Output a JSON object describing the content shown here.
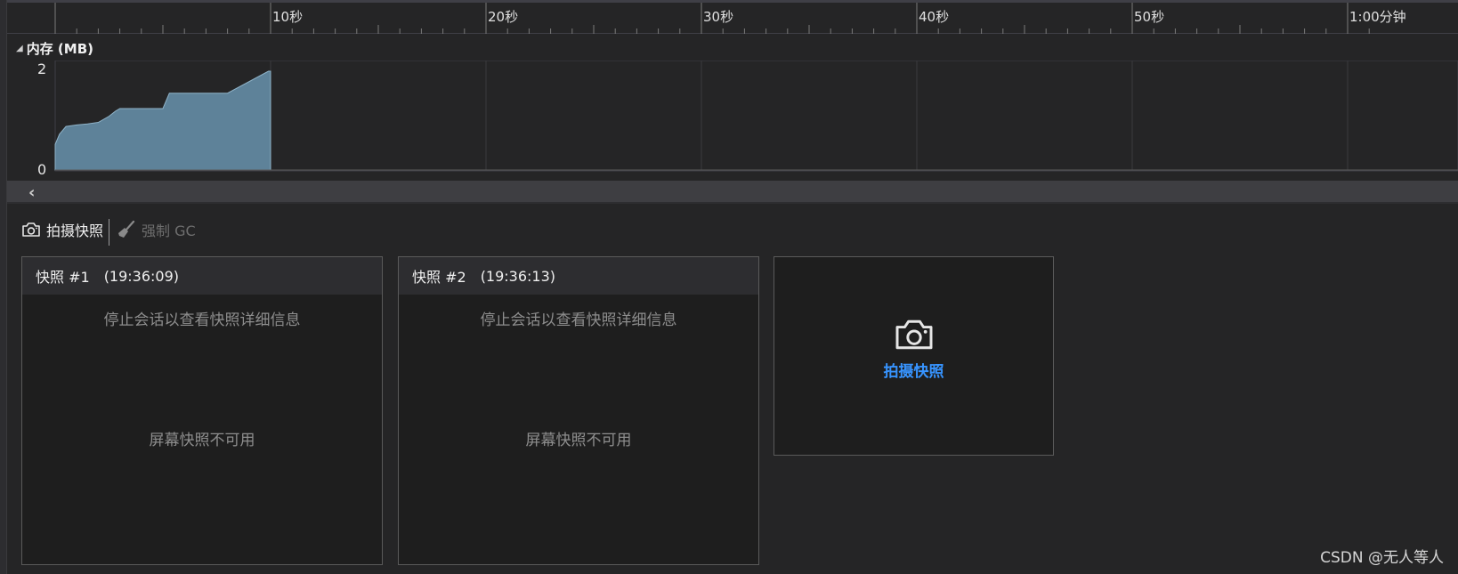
{
  "ruler": {
    "ticks": [
      "10秒",
      "20秒",
      "30秒",
      "40秒",
      "50秒",
      "1:00分钟"
    ]
  },
  "memory": {
    "title": "内存 (MB)",
    "collapse_icon": "triangle-down-icon",
    "y_max_label": "2",
    "y_min_label": "0",
    "fill_color": "#5e8299"
  },
  "chart_data": {
    "type": "area",
    "x": [
      0,
      0.2,
      0.5,
      1.0,
      1.5,
      2.0,
      2.5,
      2.8,
      3.0,
      3.5,
      5.0,
      5.3,
      6.5,
      6.8,
      8.0,
      9.9,
      10.0
    ],
    "values": [
      0.5,
      0.7,
      0.85,
      0.88,
      0.9,
      0.93,
      1.05,
      1.15,
      1.2,
      1.2,
      1.2,
      1.5,
      1.5,
      1.5,
      1.5,
      1.93,
      1.93
    ],
    "xlabel": "",
    "ylabel": "内存 (MB)",
    "xlim": [
      0,
      61
    ],
    "ylim": [
      0,
      2
    ],
    "x_ticks": [
      "10秒",
      "20秒",
      "30秒",
      "40秒",
      "50秒",
      "1:00分钟"
    ],
    "y_ticks": [
      "0",
      "2"
    ],
    "grid": true
  },
  "toolbar": {
    "take_snapshot_label": "拍摄快照",
    "force_gc_label": "强制 GC"
  },
  "snapshots": [
    {
      "title": "快照 #1",
      "time": "(19:36:09)",
      "message": "停止会话以查看快照详细信息",
      "screen_message": "屏幕快照不可用"
    },
    {
      "title": "快照 #2",
      "time": "(19:36:13)",
      "message": "停止会话以查看快照详细信息",
      "screen_message": "屏幕快照不可用"
    }
  ],
  "take_snapshot_panel": {
    "label": "拍摄快照",
    "accent_color": "#3794ff"
  },
  "watermark": "CSDN @无人等人"
}
